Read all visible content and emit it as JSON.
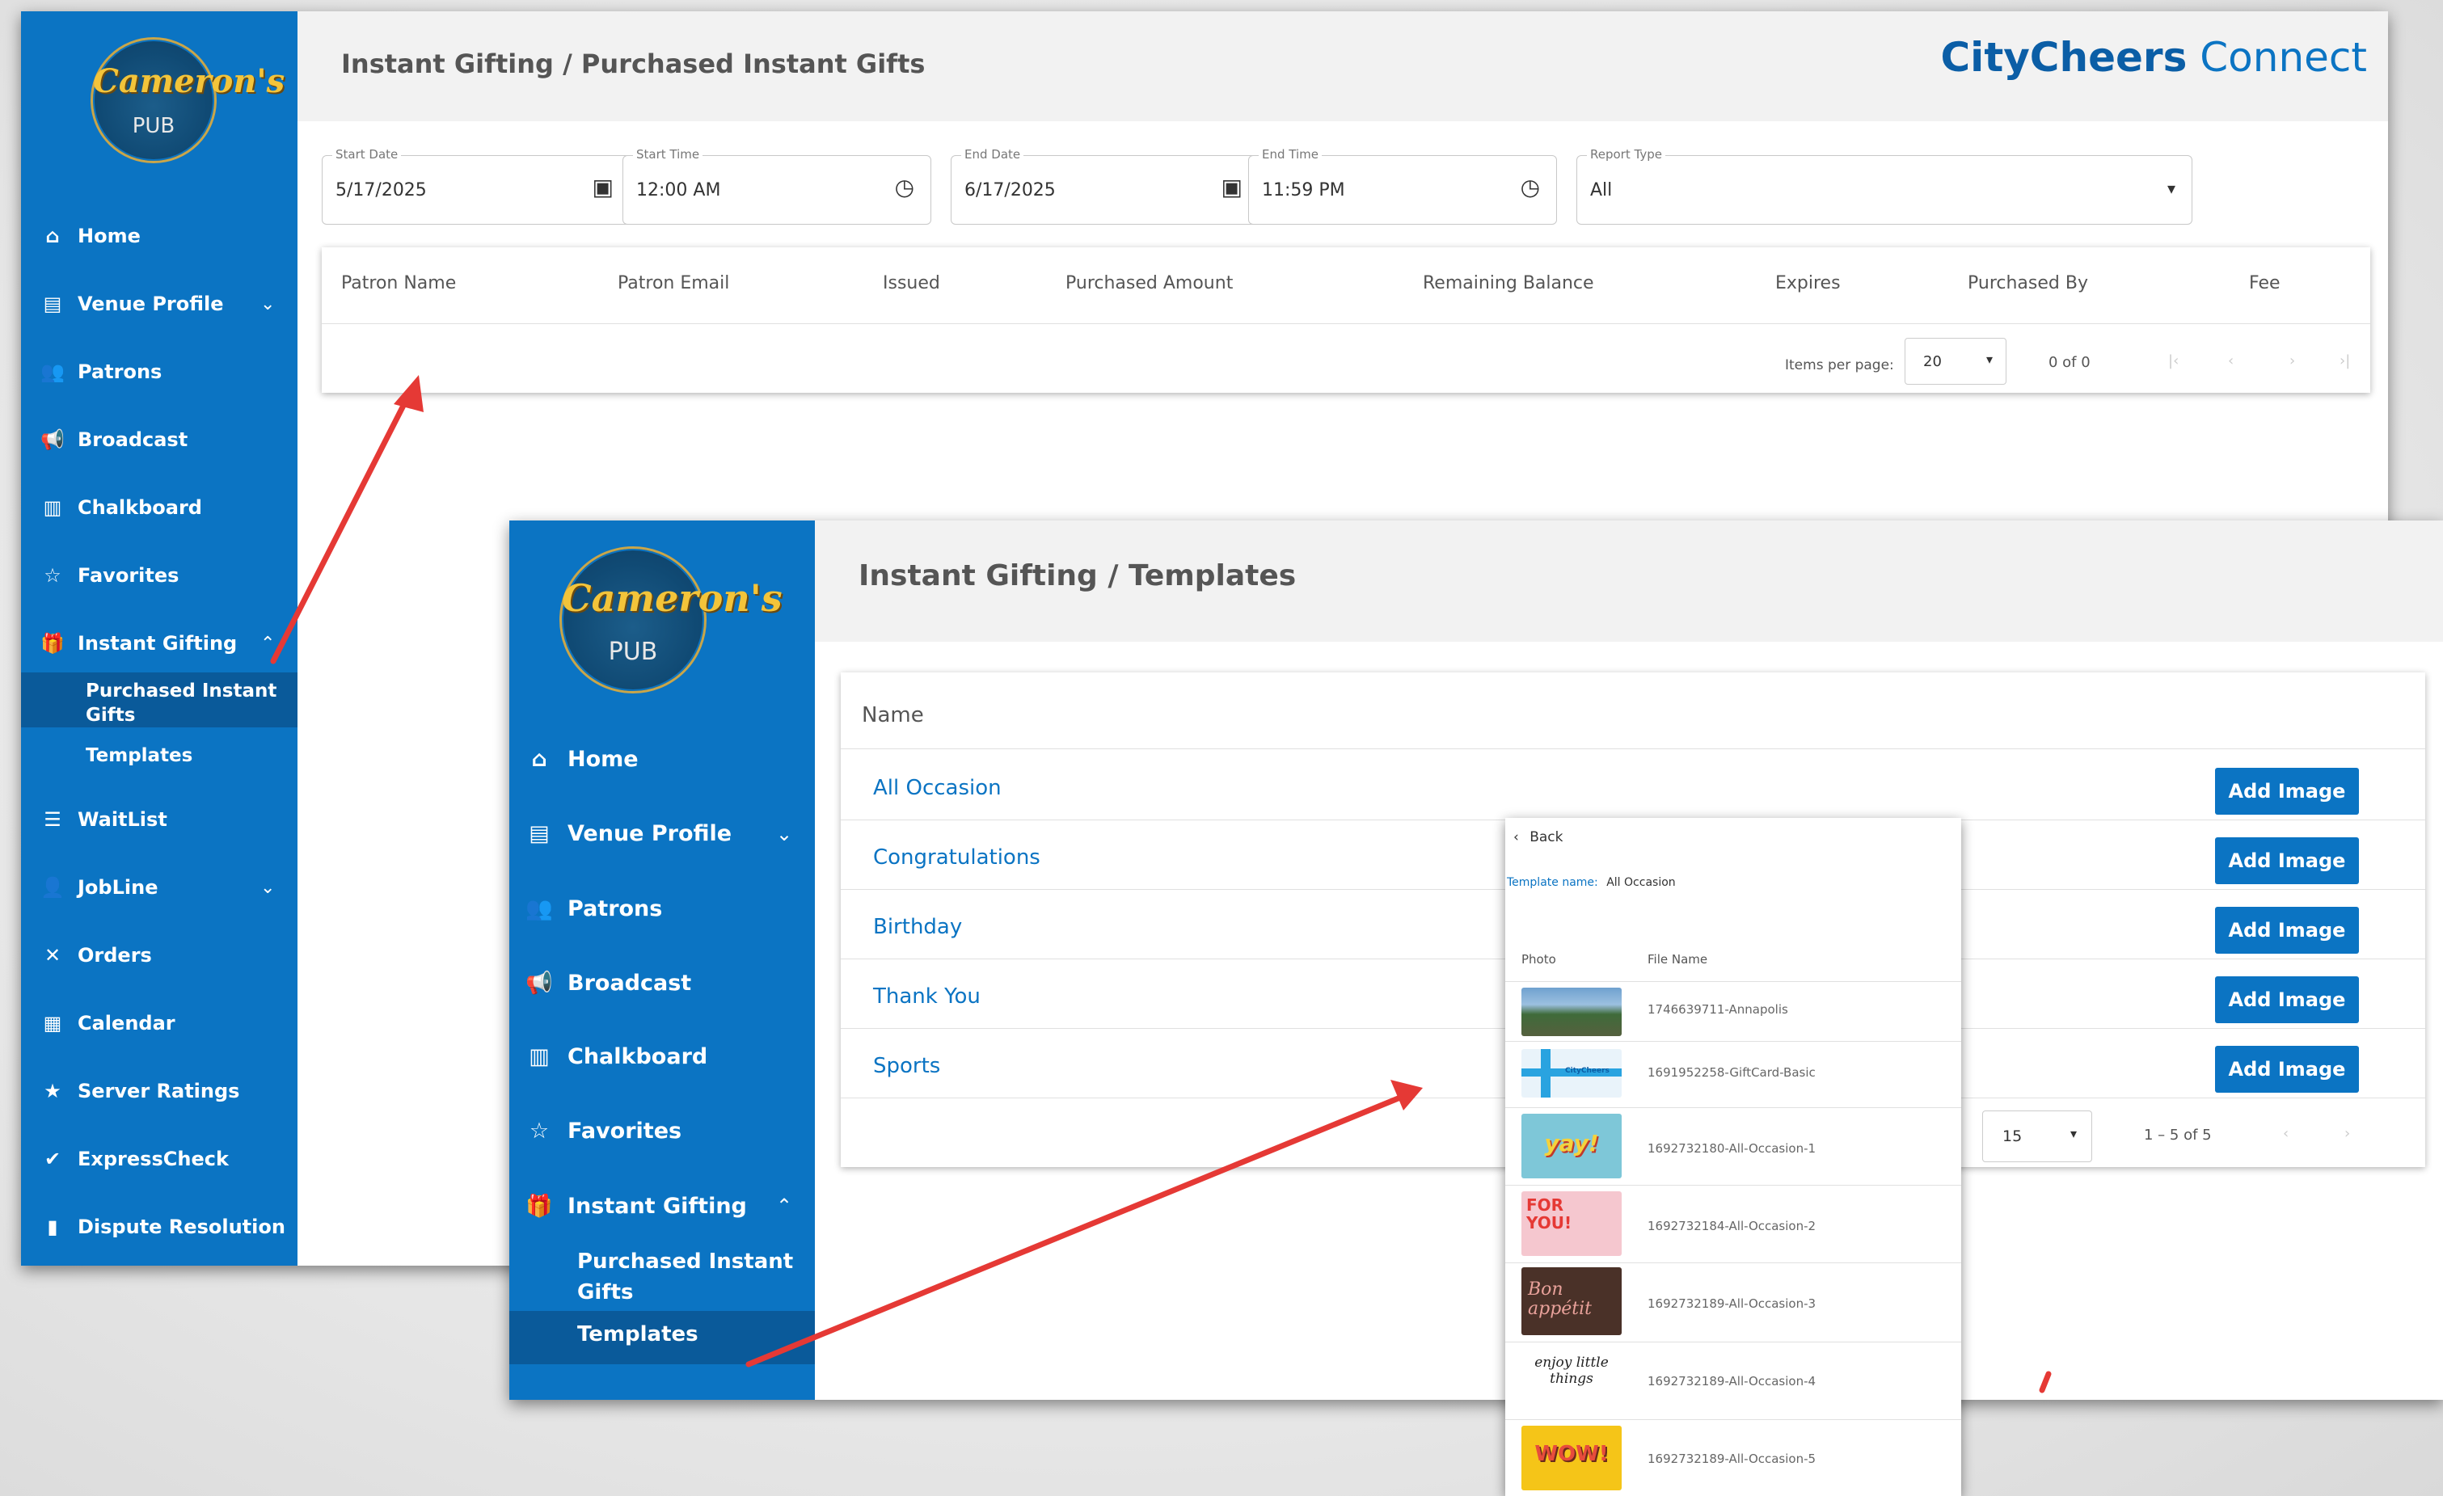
{
  "logo": {
    "line1": "Cameron's",
    "line2": "PUB"
  },
  "brand": {
    "city": "CityCheers",
    "connect": "Connect"
  },
  "colors": {
    "sidebar": "#0b74c3",
    "active_item": "#0a5a9a",
    "brand_dark": "#0b5ea6",
    "arrow": "#e53935"
  },
  "window1": {
    "title": "Instant Gifting / Purchased Instant Gifts",
    "nav": [
      {
        "label": "Home",
        "icon": "home-icon"
      },
      {
        "label": "Venue Profile",
        "icon": "storefront-icon"
      },
      {
        "label": "Patrons",
        "icon": "people-icon"
      },
      {
        "label": "Broadcast",
        "icon": "megaphone-icon"
      },
      {
        "label": "Chalkboard",
        "icon": "chalkboard-icon"
      },
      {
        "label": "Favorites",
        "icon": "star-icon"
      },
      {
        "label": "Instant Gifting",
        "icon": "gift-icon"
      },
      {
        "label": "Purchased Instant Gifts"
      },
      {
        "label": "Templates"
      },
      {
        "label": "WaitList",
        "icon": "list-icon"
      },
      {
        "label": "JobLine",
        "icon": "person-search-icon"
      },
      {
        "label": "Orders",
        "icon": "utensils-icon"
      },
      {
        "label": "Calendar",
        "icon": "calendar-icon"
      },
      {
        "label": "Server Ratings",
        "icon": "star-person-icon"
      },
      {
        "label": "ExpressCheck",
        "icon": "check-icon"
      },
      {
        "label": "Dispute Resolution",
        "icon": "document-icon"
      }
    ],
    "filters": {
      "start_date": {
        "label": "Start Date",
        "value": "5/17/2025"
      },
      "start_time": {
        "label": "Start Time",
        "value": "12:00 AM"
      },
      "end_date": {
        "label": "End Date",
        "value": "6/17/2025"
      },
      "end_time": {
        "label": "End Time",
        "value": "11:59 PM"
      },
      "report_type": {
        "label": "Report Type",
        "value": "All"
      }
    },
    "table": {
      "columns": [
        "Patron Name",
        "Patron Email",
        "Issued",
        "Purchased Amount",
        "Remaining Balance",
        "Expires",
        "Purchased By",
        "Fee"
      ],
      "items_per_page_label": "Items per page:",
      "items_per_page": "20",
      "range": "0 of 0"
    }
  },
  "window2": {
    "title": "Instant Gifting / Templates",
    "nav": [
      {
        "label": "Home",
        "icon": "home-icon"
      },
      {
        "label": "Venue Profile",
        "icon": "storefront-icon"
      },
      {
        "label": "Patrons",
        "icon": "people-icon"
      },
      {
        "label": "Broadcast",
        "icon": "megaphone-icon"
      },
      {
        "label": "Chalkboard",
        "icon": "chalkboard-icon"
      },
      {
        "label": "Favorites",
        "icon": "star-icon"
      },
      {
        "label": "Instant Gifting",
        "icon": "gift-icon"
      },
      {
        "label": "Purchased Instant Gifts"
      },
      {
        "label": "Templates"
      }
    ],
    "table": {
      "header": "Name",
      "rows": [
        "All Occasion",
        "Congratulations",
        "Birthday",
        "Thank You",
        "Sports"
      ],
      "add_image_label": "Add Image",
      "items_per_page": "15",
      "range": "1 – 5 of 5"
    }
  },
  "popup": {
    "back": "Back",
    "template_name_label": "Template name:",
    "template_name": "All Occasion",
    "col_photo": "Photo",
    "col_file": "File Name",
    "files": [
      "1746639711-Annapolis",
      "1691952258-GiftCard-Basic",
      "1692732180-All-Occasion-1",
      "1692732184-All-Occasion-2",
      "1692732189-All-Occasion-3",
      "1692732189-All-Occasion-4",
      "1692732189-All-Occasion-5"
    ],
    "thumb_text": [
      "",
      "CityCheers",
      "yay!",
      "FOR YOU!",
      "Bon appétit",
      "enjoy little things",
      "WOW!"
    ]
  }
}
